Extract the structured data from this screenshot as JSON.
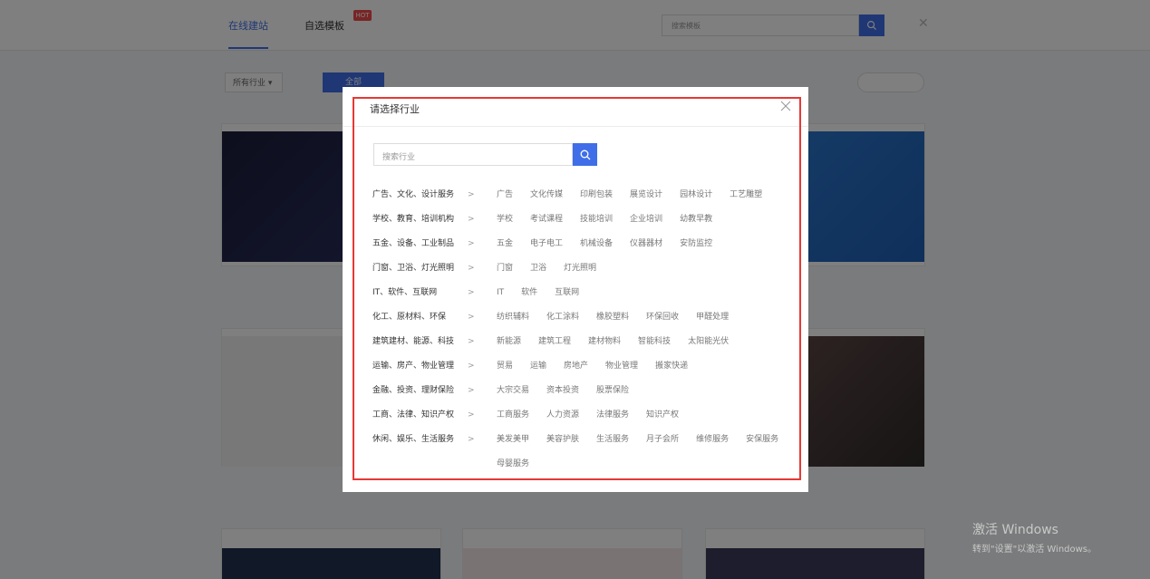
{
  "background": {
    "tabs": [
      {
        "label": "在线建站"
      },
      {
        "label": "自选模板"
      }
    ],
    "hot_badge": "HOT",
    "search_placeholder": "搜索模板",
    "filters": {
      "select_label": "所有行业 ▾",
      "active": "全部",
      "items": [
        "",
        "",
        ""
      ],
      "right_button": ""
    },
    "cards": [
      {
        "title": ""
      },
      {
        "title": ""
      },
      {
        "title": ""
      },
      {
        "title": ""
      }
    ]
  },
  "watermark": {
    "line1": "激活 Windows",
    "line2": "转到\"设置\"以激活 Windows。"
  },
  "modal": {
    "title": "请选择行业",
    "search_placeholder": "搜索行业",
    "categories": [
      {
        "name": "广告、文化、设计服务",
        "subs": [
          "广告",
          "文化传媒",
          "印刷包装",
          "展览设计",
          "园林设计",
          "工艺雕塑"
        ]
      },
      {
        "name": "学校、教育、培训机构",
        "subs": [
          "学校",
          "考试课程",
          "技能培训",
          "企业培训",
          "幼教早教"
        ]
      },
      {
        "name": "五金、设备、工业制品",
        "subs": [
          "五金",
          "电子电工",
          "机械设备",
          "仪器器材",
          "安防监控"
        ]
      },
      {
        "name": "门窗、卫浴、灯光照明",
        "subs": [
          "门窗",
          "卫浴",
          "灯光照明"
        ]
      },
      {
        "name": "IT、软件、互联网",
        "subs": [
          "IT",
          "软件",
          "互联网"
        ]
      },
      {
        "name": "化工、原材料、环保",
        "subs": [
          "纺织辅料",
          "化工涂料",
          "橡胶塑料",
          "环保回收",
          "甲醛处理"
        ]
      },
      {
        "name": "建筑建材、能源、科技",
        "subs": [
          "新能源",
          "建筑工程",
          "建材物料",
          "智能科技",
          "太阳能光伏"
        ]
      },
      {
        "name": "运输、房产、物业管理",
        "subs": [
          "贸易",
          "运输",
          "房地产",
          "物业管理",
          "搬家快递"
        ]
      },
      {
        "name": "金融、投资、理财保险",
        "subs": [
          "大宗交易",
          "资本投资",
          "股票保险"
        ]
      },
      {
        "name": "工商、法律、知识产权",
        "subs": [
          "工商服务",
          "人力资源",
          "法律服务",
          "知识产权"
        ]
      },
      {
        "name": "休闲、娱乐、生活服务",
        "subs": [
          "美发美甲",
          "美容护肤",
          "生活服务",
          "月子会所",
          "维修服务",
          "安保服务",
          "母婴服务"
        ]
      }
    ],
    "arrow_glyph": ">"
  },
  "icons": {
    "search": "search-icon",
    "close": "close-icon",
    "chevron": "chevron-right-icon"
  },
  "colors": {
    "accent": "#3f6ee8",
    "highlight_border": "#e53935",
    "badge": "#f04a4a"
  }
}
